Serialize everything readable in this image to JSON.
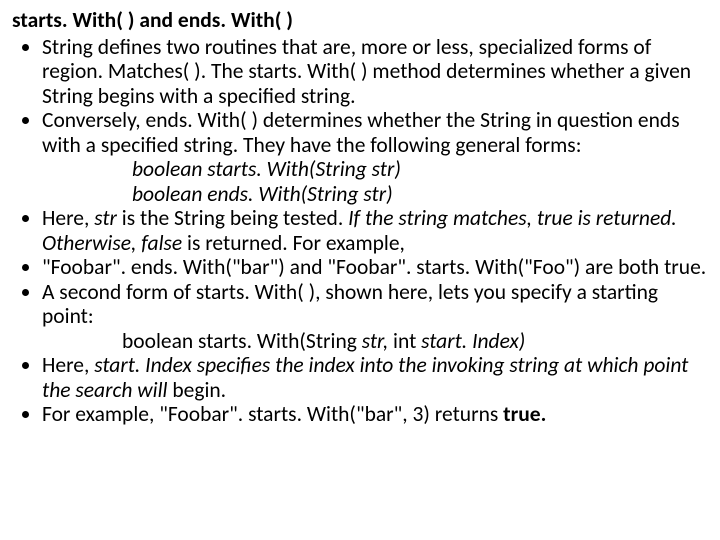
{
  "title": "starts. With( ) and ends. With( )",
  "bullets": [
    {
      "text": "String defines two routines that are, more or less, specialized forms of region. Matches( ). The starts. With( ) method determines whether a given String begins with a specified string."
    },
    {
      "text": "Conversely, ends. With( ) determines whether the String in question ends with a specified string. They have the following general forms:",
      "sig1_pre": "boolean starts. With(String ",
      "sig1_it": "str)",
      "sig2_pre": "boolean ends. With(String ",
      "sig2_it": "str)"
    },
    {
      "pre": "Here, ",
      "it1": "str ",
      "mid1": "is the String being tested. ",
      "it2": "If the string matches, true is returned. Otherwise, false ",
      "mid2": "is returned. For example,"
    },
    {
      "text": "\"Foobar\". ends. With(\"bar\")    and   \"Foobar\". starts. With(\"Foo\") are both true."
    },
    {
      "text": "A second form of starts. With( ), shown here, lets you specify a starting point:",
      "sig_pre": "boolean starts. With(String ",
      "sig_it": "str, ",
      "sig_mid": "int ",
      "sig_it2": "start. Index)"
    },
    {
      "pre": "Here, ",
      "it1": "start. Index specifies the index into the invoking string at which point the search will ",
      "post": "begin."
    },
    {
      "pre": "For example, \"Foobar\". starts. With(\"bar\", 3) returns ",
      "bold": "true."
    }
  ]
}
